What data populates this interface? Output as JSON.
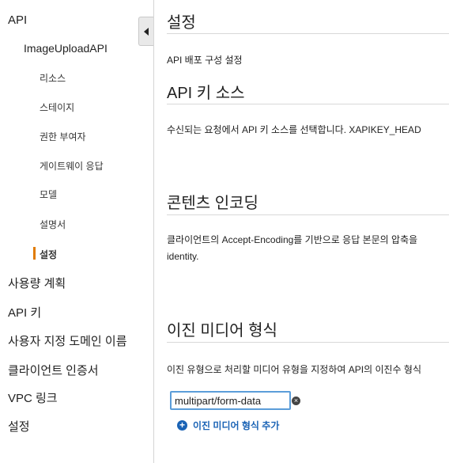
{
  "sidebar": {
    "api_label": "API",
    "api_name": "ImageUploadAPI",
    "sub_items": [
      {
        "label": "리소스"
      },
      {
        "label": "스테이지"
      },
      {
        "label": "권한 부여자"
      },
      {
        "label": "게이트웨이 응답"
      },
      {
        "label": "모델"
      },
      {
        "label": "설명서"
      },
      {
        "label": "설정",
        "active": true
      }
    ],
    "top_items": [
      {
        "label": "사용량 계획"
      },
      {
        "label": "API 키"
      },
      {
        "label": "사용자 지정 도메인 이름"
      },
      {
        "label": "클라이언트 인증서"
      },
      {
        "label": "VPC 링크"
      },
      {
        "label": "설정"
      }
    ]
  },
  "main": {
    "page_title": "설정",
    "page_subtitle": "API 배포 구성 설정",
    "api_key_source": {
      "title": "API 키 소스",
      "description": "수신되는 요청에서 API 키 소스를 선택합니다. XAPIKEY_HEAD"
    },
    "content_encoding": {
      "title": "콘텐츠 인코딩",
      "description_line1": "클라이언트의 Accept-Encoding를 기반으로 응답 본문의 압축을",
      "description_line2": "identity."
    },
    "binary_media": {
      "title": "이진 미디어 형식",
      "description": "이진 유형으로 처리할 미디어 유형을 지정하여 API의 이진수 형식",
      "input_value": "multipart/form-data",
      "add_label": "이진 미디어 형식 추가"
    }
  },
  "colors": {
    "accent_active": "#e07b00",
    "link_blue": "#1a63b5",
    "input_focus": "#5b9dd9"
  }
}
